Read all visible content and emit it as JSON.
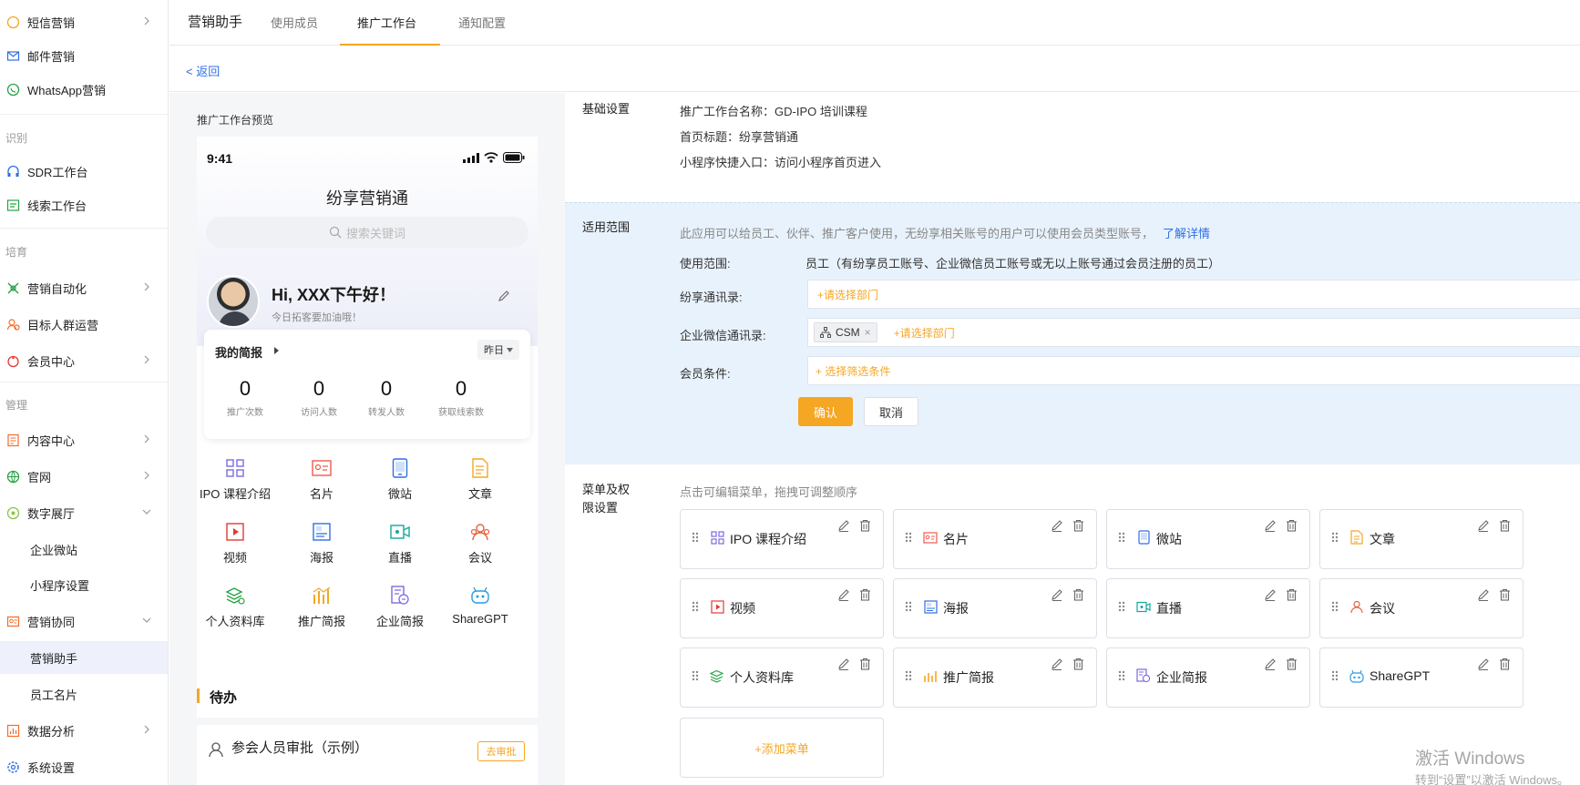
{
  "sidebar": {
    "items": [
      {
        "label": "短信营销",
        "icon": "chat-bubble-icon",
        "chevron": true
      },
      {
        "label": "邮件营销",
        "icon": "mail-icon",
        "chevron": false
      },
      {
        "label": "WhatsApp营销",
        "icon": "whatsapp-icon",
        "chevron": false
      },
      {
        "label": "SDR工作台",
        "icon": "headset-icon",
        "chevron": false
      },
      {
        "label": "线索工作台",
        "icon": "leads-icon",
        "chevron": false
      },
      {
        "label": "营销自动化",
        "icon": "automation-icon",
        "chevron": true
      },
      {
        "label": "目标人群运营",
        "icon": "audience-icon",
        "chevron": false
      },
      {
        "label": "会员中心",
        "icon": "member-icon",
        "chevron": true
      },
      {
        "label": "内容中心",
        "icon": "content-icon",
        "chevron": true
      },
      {
        "label": "官网",
        "icon": "globe-icon",
        "chevron": true
      },
      {
        "label": "数字展厅",
        "icon": "showroom-icon",
        "chevron": true
      },
      {
        "label": "企业微站",
        "icon": "",
        "chevron": false
      },
      {
        "label": "小程序设置",
        "icon": "",
        "chevron": false
      },
      {
        "label": "营销协同",
        "icon": "collab-icon",
        "chevron": true
      },
      {
        "label": "营销助手",
        "icon": "",
        "chevron": false
      },
      {
        "label": "员工名片",
        "icon": "",
        "chevron": false
      },
      {
        "label": "数据分析",
        "icon": "analytics-icon",
        "chevron": true
      },
      {
        "label": "系统设置",
        "icon": "settings-icon",
        "chevron": false
      }
    ],
    "groups": [
      "识别",
      "培育",
      "管理"
    ]
  },
  "topbar": {
    "title": "营销助手",
    "tabs": [
      "使用成员",
      "推广工作台",
      "通知配置"
    ],
    "active_tab": "推广工作台"
  },
  "back_link": "< 返回",
  "preview": {
    "label": "推广工作台预览",
    "time": "9:41",
    "title": "纷享营销通",
    "search_placeholder": "搜索关键词",
    "greeting": "Hi, XXX下午好！",
    "greeting_sub": "今日拓客要加油哦！",
    "brief_title": "我的简报",
    "brief_select": "昨日",
    "stats": [
      {
        "value": "0",
        "label": "推广次数"
      },
      {
        "value": "0",
        "label": "访问人数"
      },
      {
        "value": "0",
        "label": "转发人数"
      },
      {
        "value": "0",
        "label": "获取线索数"
      }
    ],
    "menu": [
      {
        "label": "IPO 课程介绍",
        "icon": "grid-icon"
      },
      {
        "label": "名片",
        "icon": "card-icon"
      },
      {
        "label": "微站",
        "icon": "mobile-icon"
      },
      {
        "label": "文章",
        "icon": "article-icon"
      },
      {
        "label": "视频",
        "icon": "video-icon"
      },
      {
        "label": "海报",
        "icon": "poster-icon"
      },
      {
        "label": "直播",
        "icon": "live-icon"
      },
      {
        "label": "会议",
        "icon": "meeting-icon"
      },
      {
        "label": "个人资料库",
        "icon": "library-icon"
      },
      {
        "label": "推广简报",
        "icon": "report-icon"
      },
      {
        "label": "企业简报",
        "icon": "company-report-icon"
      },
      {
        "label": "ShareGPT",
        "icon": "robot-icon"
      }
    ],
    "todo_title": "待办",
    "todo_item": "参会人员审批（示例）",
    "todo_button": "去审批"
  },
  "basic": {
    "section": "基础设置",
    "name_label": "推广工作台名称：",
    "name_value": "GD-IPO 培训课程",
    "home_label": "首页标题：",
    "home_value": "纷享营销通",
    "entry_label": "小程序快捷入口：",
    "entry_value": "访问小程序首页进入"
  },
  "scope": {
    "section": "适用范围",
    "hint": "此应用可以给员工、伙伴、推广客户使用，无纷享相关账号的用户可以使用会员类型账号，",
    "hint_link": "了解详情",
    "range_label": "使用范围:",
    "range_value": "员工（有纷享员工账号、企业微信员工账号或无以上账号通过会员注册的员工）",
    "fs_label": "纷享通讯录:",
    "fs_placeholder": "+请选择部门",
    "wx_label": "企业微信通讯录:",
    "wx_tag": "CSM",
    "wx_placeholder": "+请选择部门",
    "member_label": "会员条件:",
    "member_placeholder": "+ 选择筛选条件",
    "ok": "确认",
    "cancel": "取消"
  },
  "menu_settings": {
    "section_line1": "菜单及权",
    "section_line2": "限设置",
    "hint": "点击可编辑菜单，拖拽可调整顺序",
    "cards": [
      {
        "label": "IPO 课程介绍",
        "icon": "grid-icon"
      },
      {
        "label": "名片",
        "icon": "card-icon"
      },
      {
        "label": "微站",
        "icon": "mobile-icon"
      },
      {
        "label": "文章",
        "icon": "article-icon"
      },
      {
        "label": "视频",
        "icon": "video-icon"
      },
      {
        "label": "海报",
        "icon": "poster-icon"
      },
      {
        "label": "直播",
        "icon": "live-icon"
      },
      {
        "label": "会议",
        "icon": "meeting-icon"
      },
      {
        "label": "个人资料库",
        "icon": "library-icon"
      },
      {
        "label": "推广简报",
        "icon": "report-icon"
      },
      {
        "label": "企业简报",
        "icon": "company-report-icon"
      },
      {
        "label": "ShareGPT",
        "icon": "robot-icon"
      }
    ],
    "add": "+添加菜单"
  },
  "watermark": {
    "line1": "激活 Windows",
    "line2": "转到“设置”以激活 Windows。"
  },
  "colors": {
    "accent": "#f5a623",
    "link": "#2f6fe4",
    "scope_bg": "#e8f2fc"
  }
}
